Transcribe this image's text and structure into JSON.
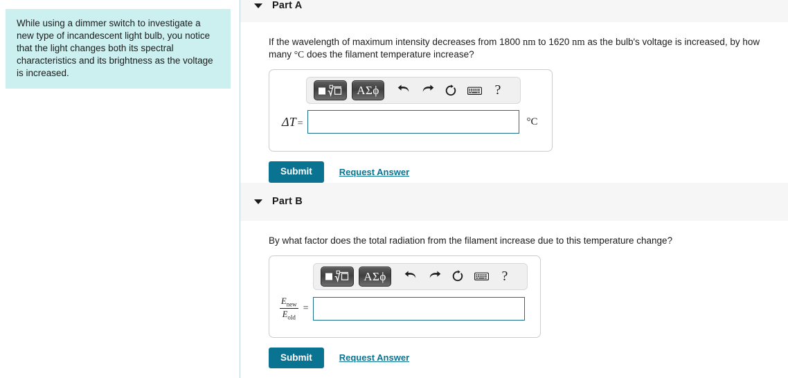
{
  "problem": {
    "statement": "While using a dimmer switch to investigate a new type of incandescent light bulb, you notice that the light changes both its spectral characteristics and its brightness as the voltage is increased."
  },
  "parts": [
    {
      "id": "part-a",
      "header": "Part A",
      "caret_icon": "chevron-down-icon",
      "question_segments": {
        "lead": "If the wavelength of maximum intensity decreases from",
        "value_from": "1800",
        "unit_from": "nm",
        "mid": "to",
        "value_to": "1620",
        "unit_to": "nm",
        "tail": "as the bulb's voltage is increased, by how many",
        "unit_deg": "°C",
        "end": "does the filament temperature increase?"
      },
      "answer": {
        "label_symbol": "ΔT",
        "label_equals": "=",
        "value": "",
        "placeholder": "",
        "unit": "°C"
      },
      "submit_label": "Submit",
      "request_answer_label": "Request Answer"
    },
    {
      "id": "part-b",
      "header": "Part B",
      "caret_icon": "chevron-down-icon",
      "question_text": "By what factor does the total radiation from the filament increase due to this temperature change?",
      "answer": {
        "fraction_numerator": "E",
        "fraction_numerator_sub": "new",
        "fraction_denominator": "E",
        "fraction_denominator_sub": "old",
        "label_equals": "=",
        "value": "",
        "placeholder": ""
      },
      "submit_label": "Submit",
      "request_answer_label": "Request Answer"
    }
  ],
  "math_toolbar": {
    "buttons": [
      {
        "name": "math-template-button",
        "label": "■√□",
        "type": "template"
      },
      {
        "name": "greek-symbols-button",
        "label": "ΑΣϕ",
        "type": "symbols"
      }
    ],
    "icons": [
      {
        "name": "undo-icon",
        "glyph": "↶"
      },
      {
        "name": "redo-icon",
        "glyph": "↷"
      },
      {
        "name": "reset-icon",
        "glyph": "↻"
      },
      {
        "name": "keyboard-icon",
        "glyph": "⌨"
      },
      {
        "name": "help-icon",
        "glyph": "?"
      }
    ]
  },
  "colors": {
    "accent_teal": "#0a7392",
    "input_border": "#1a6f8b",
    "intro_background": "#ccf0ef",
    "band_background": "#f6f6f6",
    "divider": "#b9d3dd"
  }
}
